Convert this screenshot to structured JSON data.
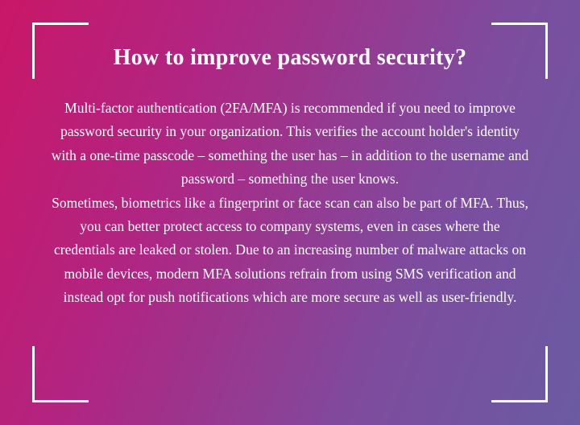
{
  "heading": "How to improve password security?",
  "body": "Multi-factor authentication (2FA/MFA) is recommended if you need to improve password security in your organization. This verifies the account holder's identity with a one-time passcode – something the user has – in addition to the username and password – something the user knows.\nSometimes, biometrics like a fingerprint or face scan can also be part of MFA. Thus, you can better protect access to company systems, even in cases where the credentials are leaked or stolen. Due to an increasing number of malware attacks on mobile devices, modern MFA solutions refrain from using SMS verification and instead opt for push notifications which are more secure as well as user-friendly."
}
